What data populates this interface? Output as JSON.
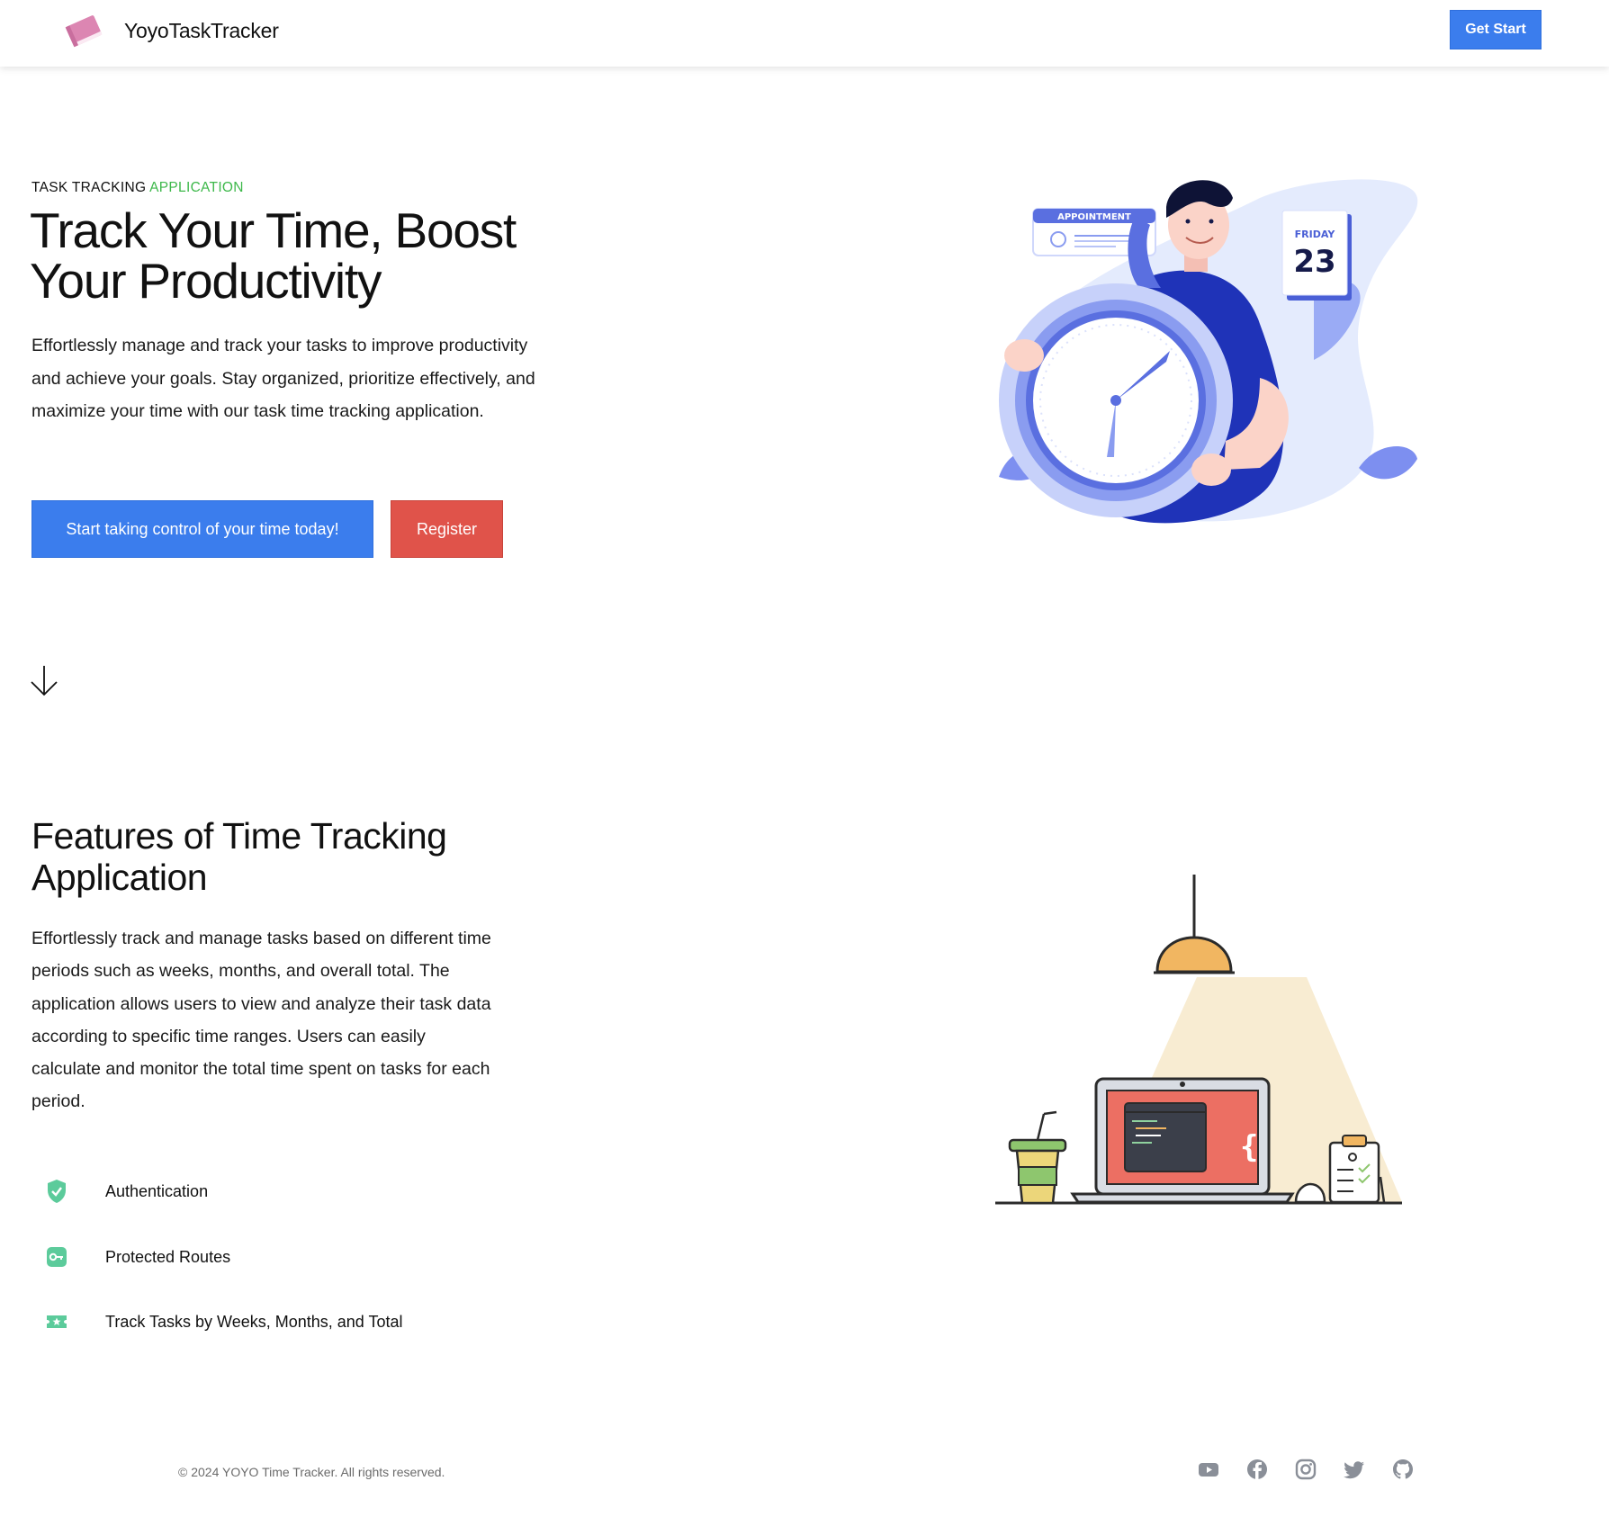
{
  "brand": {
    "name": "YoyoTaskTracker",
    "logo_icon": "book-icon",
    "logo_color": "#e191b9"
  },
  "nav": {
    "cta_label": "Get Start"
  },
  "hero": {
    "eyebrow_prefix": "TASK TRACKING",
    "eyebrow_accent": "APPLICATION",
    "title": "Track Your Time, Boost Your Productivity",
    "description": "Effortlessly manage and track your tasks to improve productivity and achieve your goals. Stay organized, prioritize effectively, and maximize your time with our task time tracking application.",
    "primary_button": "Start taking control of your time today!",
    "secondary_button": "Register",
    "illustration": {
      "appointment_label": "APPOINTMENT",
      "calendar_day": "FRIDAY",
      "calendar_date": "23"
    },
    "scroll_icon": "arrow-down-icon"
  },
  "features": {
    "title": "Features of Time Tracking Application",
    "description": "Effortlessly track and manage tasks based on different time periods such as weeks, months, and overall total. The application allows users to view and analyze their task data according to specific time ranges. Users can easily calculate and monitor the total time spent on tasks for each period.",
    "items": [
      {
        "label": "Authentication",
        "icon": "shield-check-icon"
      },
      {
        "label": "Protected Routes",
        "icon": "key-icon"
      },
      {
        "label": "Track Tasks by Weeks, Months, and Total",
        "icon": "ticket-star-icon"
      }
    ]
  },
  "footer": {
    "copyright": "© 2024 YOYO Time Tracker. All rights reserved.",
    "social": [
      "youtube-icon",
      "facebook-icon",
      "instagram-icon",
      "twitter-icon",
      "github-icon"
    ]
  },
  "colors": {
    "primary": "#3b7ded",
    "danger": "#e0534a",
    "accent_green": "#3db84a",
    "feature_icon": "#5ccb9b",
    "illustration_blue": "#5a6fe0"
  }
}
